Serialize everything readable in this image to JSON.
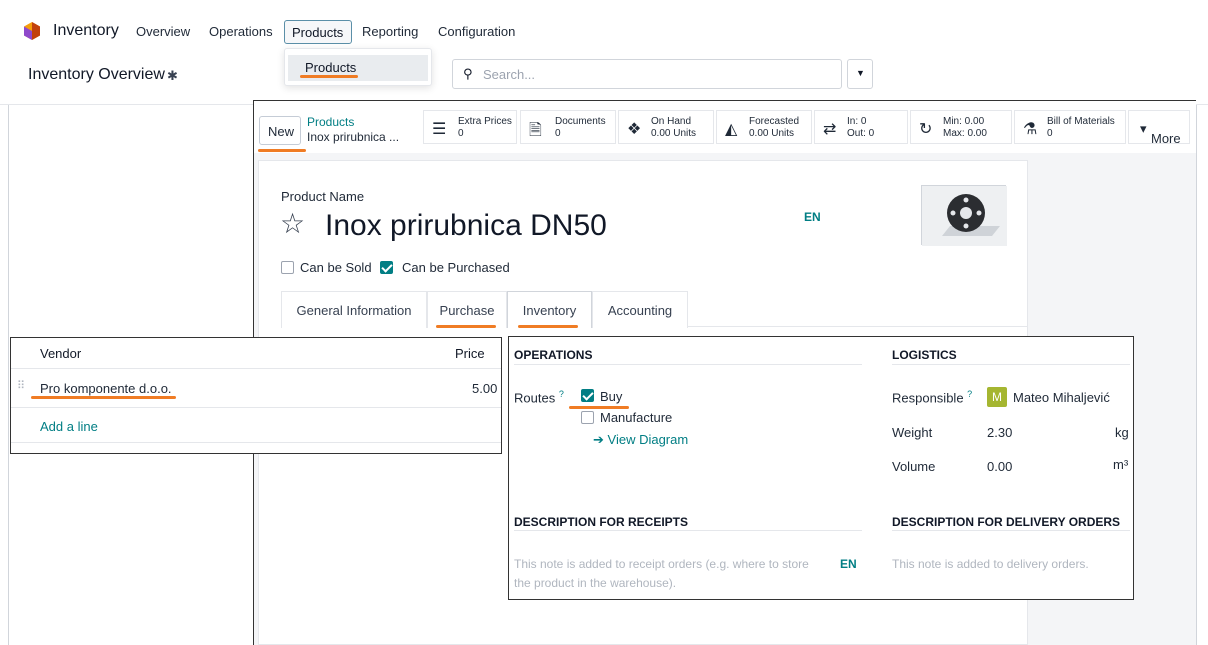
{
  "nav": {
    "app_name": "Inventory",
    "items": [
      "Overview",
      "Operations",
      "Products",
      "Reporting",
      "Configuration"
    ],
    "dropdown_item": "Products"
  },
  "subbar": {
    "page_title": "Inventory Overview",
    "search_placeholder": "Search..."
  },
  "control_panel": {
    "new_label": "New",
    "breadcrumb_parent": "Products",
    "breadcrumb_current": "Inox prirubnica ...",
    "smart_buttons": [
      {
        "icon": "list-icon",
        "line1": "Extra Prices",
        "line2": "0"
      },
      {
        "icon": "document-icon",
        "line1": "Documents",
        "line2": "0"
      },
      {
        "icon": "cubes-icon",
        "line1": "On Hand",
        "line2": "0.00 Units"
      },
      {
        "icon": "area-chart-icon",
        "line1": "Forecasted",
        "line2": "0.00 Units"
      },
      {
        "icon": "exchange-icon",
        "line1": "In: 0",
        "line2": "Out: 0"
      },
      {
        "icon": "refresh-icon",
        "line1": "Min: 0.00",
        "line2": "Max: 0.00"
      },
      {
        "icon": "flask-icon",
        "line1": "Bill of Materials",
        "line2": "0"
      }
    ],
    "more_label": "More"
  },
  "form": {
    "product_name_label": "Product Name",
    "product_name": "Inox prirubnica DN50",
    "lang_tag": "EN",
    "can_be_sold": "Can be Sold",
    "can_be_purchased": "Can be Purchased",
    "tabs": [
      "General Information",
      "Purchase",
      "Inventory",
      "Accounting"
    ]
  },
  "vendor_table": {
    "col_vendor": "Vendor",
    "col_price": "Price",
    "rows": [
      {
        "vendor": "Pro komponente d.o.o.",
        "price": "5.00"
      }
    ],
    "add_line": "Add a line"
  },
  "inventory_tab": {
    "operations_title": "OPERATIONS",
    "routes_label": "Routes",
    "help_mark": "?",
    "route_buy": "Buy",
    "route_manufacture": "Manufacture",
    "view_diagram": "View Diagram",
    "logistics_title": "LOGISTICS",
    "responsible_label": "Responsible",
    "responsible_initial": "M",
    "responsible_name": "Mateo Mihaljević",
    "weight_label": "Weight",
    "weight_value": "2.30",
    "weight_unit": "kg",
    "volume_label": "Volume",
    "volume_value": "0.00",
    "volume_unit": "m³",
    "desc_receipts_title": "DESCRIPTION FOR RECEIPTS",
    "desc_receipts_line1": "This note is added to receipt orders (e.g. where to store",
    "desc_receipts_line2": "the product in the warehouse).",
    "desc_receipts_lang": "EN",
    "desc_delivery_title": "DESCRIPTION FOR DELIVERY ORDERS",
    "desc_delivery_note": "This note is added to delivery orders."
  },
  "colors": {
    "accent": "#017e84",
    "highlight": "#f07c24",
    "avatar": "#a5b631"
  }
}
